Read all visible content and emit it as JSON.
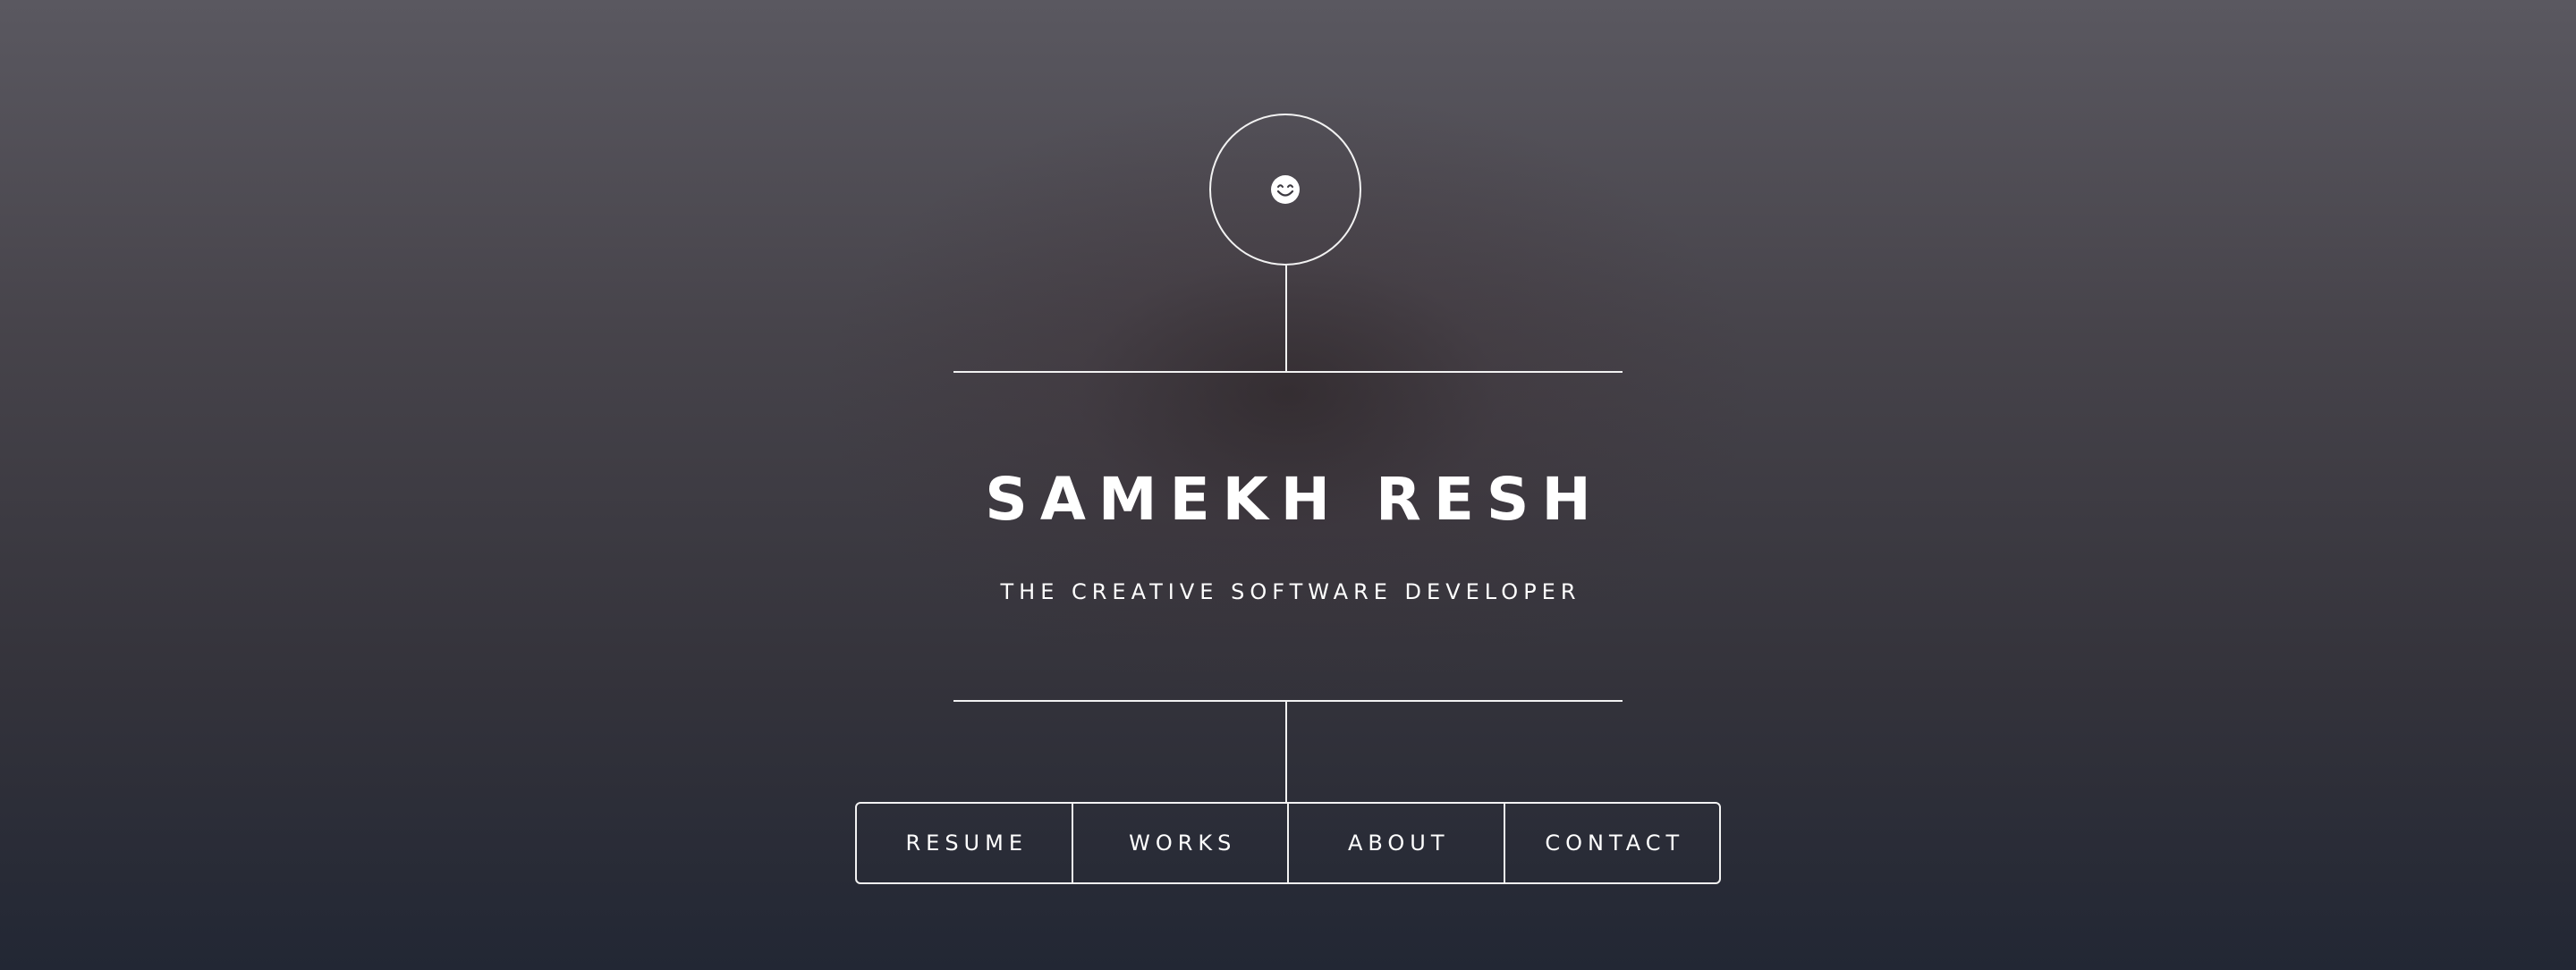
{
  "header": {
    "name": "SAMEKH RESH",
    "tagline": "THE CREATIVE SOFTWARE DEVELOPER",
    "logo_icon": "smiling-face-icon"
  },
  "nav": {
    "items": [
      {
        "label": "RESUME"
      },
      {
        "label": "WORKS"
      },
      {
        "label": "ABOUT"
      },
      {
        "label": "CONTACT"
      }
    ]
  },
  "colors": {
    "line": "#f2f2f2",
    "text": "#ffffff",
    "background_top": "#5a5860",
    "background_bottom": "#222734"
  }
}
